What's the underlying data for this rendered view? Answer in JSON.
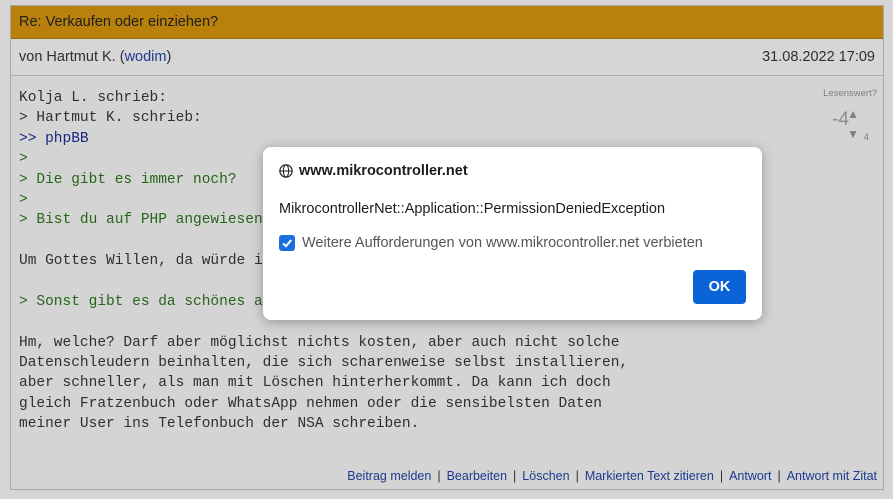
{
  "post": {
    "title": "Re: Verkaufen oder einziehen?",
    "author_prefix": "von Hartmut K. (",
    "author_handle": "wodim",
    "author_suffix": ")",
    "date": "31.08.2022 17:09",
    "rating": {
      "label": "Lesenswert?",
      "score": "-4",
      "votes": "4",
      "up_icon": "triangle-up-icon",
      "down_icon": "triangle-down-icon"
    },
    "lines": [
      {
        "text": "Kolja L. schrieb:",
        "style": "plain"
      },
      {
        "text": "> Hartmut K. schrieb:",
        "style": "plain"
      },
      {
        "text": ">> phpBB",
        "style": "q2"
      },
      {
        "text": ">",
        "style": "q1"
      },
      {
        "text": "> Die gibt es immer noch?",
        "style": "q1"
      },
      {
        "text": ">",
        "style": "q1"
      },
      {
        "text": "> Bist du auf PHP angewiesen",
        "style": "q1"
      },
      {
        "text": "",
        "style": "plain"
      },
      {
        "text": "Um Gottes Willen, da würde i",
        "style": "plain"
      },
      {
        "text": "",
        "style": "plain"
      },
      {
        "text": "> Sonst gibt es da schönes a",
        "style": "q1"
      },
      {
        "text": "",
        "style": "plain"
      },
      {
        "text": "Hm, welche? Darf aber möglichst nichts kosten, aber auch nicht solche",
        "style": "plain"
      },
      {
        "text": "Datenschleudern beinhalten, die sich scharenweise selbst installieren,",
        "style": "plain"
      },
      {
        "text": "aber schneller, als man mit Löschen hinterherkommt. Da kann ich doch",
        "style": "plain"
      },
      {
        "text": "gleich Fratzenbuch oder WhatsApp nehmen oder die sensibelsten Daten",
        "style": "plain"
      },
      {
        "text": "meiner User ins Telefonbuch der NSA schreiben.",
        "style": "plain"
      }
    ],
    "footer_links": [
      "Beitrag melden",
      "Bearbeiten",
      "Löschen",
      "Markierten Text zitieren",
      "Antwort",
      "Antwort mit Zitat"
    ],
    "footer_separator": "|"
  },
  "dialog": {
    "site_icon": "globe-icon",
    "site": "www.mikrocontroller.net",
    "message": "MikrocontrollerNet::Application::PermissionDeniedException",
    "checkbox_label": "Weitere Aufforderungen von www.mikrocontroller.net verbieten",
    "checkbox_checked": true,
    "ok_label": "OK"
  }
}
